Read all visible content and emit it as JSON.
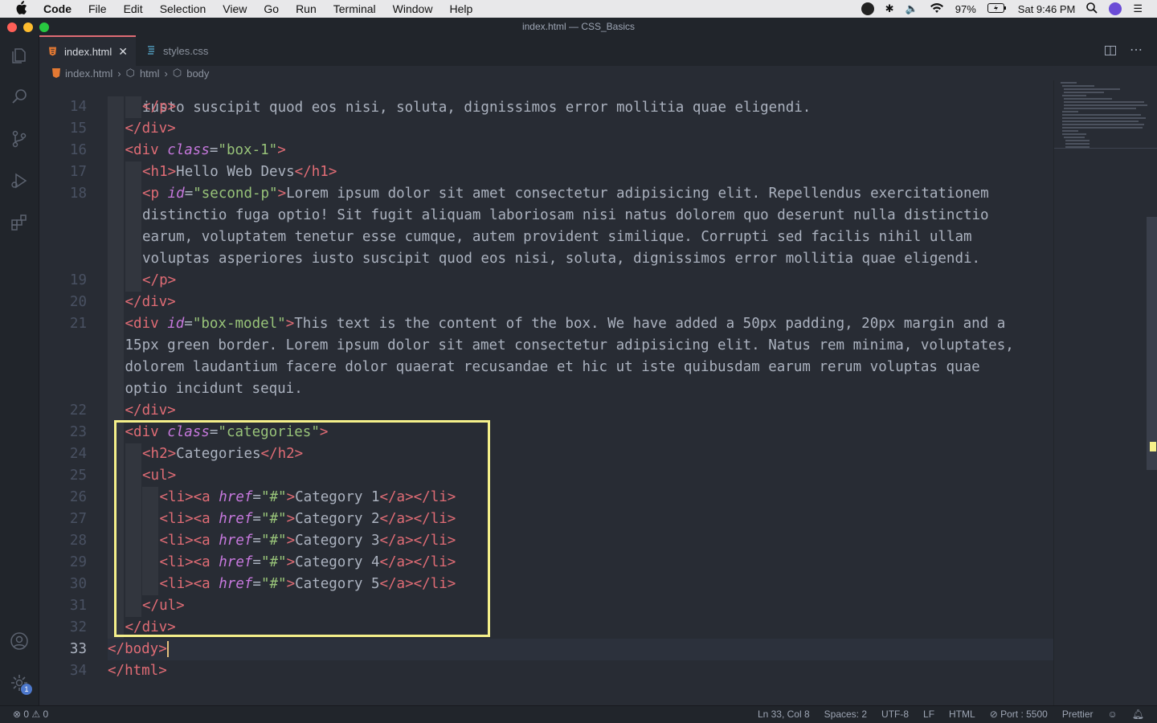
{
  "menubar": {
    "app": "Code",
    "items": [
      "File",
      "Edit",
      "Selection",
      "View",
      "Go",
      "Run",
      "Terminal",
      "Window",
      "Help"
    ],
    "battery": "97%",
    "clock": "Sat 9:46 PM"
  },
  "window": {
    "title": "index.html — CSS_Basics"
  },
  "tabs": [
    {
      "label": "index.html",
      "active": true
    },
    {
      "label": "styles.css",
      "active": false
    }
  ],
  "breadcrumb": [
    "index.html",
    "html",
    "body"
  ],
  "editor": {
    "top_partial": "iusto suscipit quod eos nisi, soluta, dignissimos error mollitia quae eligendi.",
    "lines": [
      {
        "n": "14",
        "ind": 2,
        "segs": [
          [
            "t",
            "</p>"
          ]
        ]
      },
      {
        "n": "15",
        "ind": 1,
        "segs": [
          [
            "t",
            "</div>"
          ]
        ]
      },
      {
        "n": "16",
        "ind": 1,
        "segs": [
          [
            "t",
            "<div "
          ],
          [
            "a",
            "class"
          ],
          [
            "p",
            "="
          ],
          [
            "s",
            "\"box-1\""
          ],
          [
            "t",
            ">"
          ]
        ]
      },
      {
        "n": "17",
        "ind": 2,
        "segs": [
          [
            "t",
            "<h1>"
          ],
          [
            "p",
            "Hello Web Devs"
          ],
          [
            "t",
            "</h1>"
          ]
        ]
      },
      {
        "n": "18",
        "ind": 2,
        "segs": [
          [
            "t",
            "<p "
          ],
          [
            "a",
            "id"
          ],
          [
            "p",
            "="
          ],
          [
            "s",
            "\"second-p\""
          ],
          [
            "t",
            ">"
          ],
          [
            "p",
            "Lorem ipsum dolor sit amet consectetur adipisicing elit. Repellendus exercitationem"
          ]
        ]
      },
      {
        "n": "",
        "ind": 2,
        "segs": [
          [
            "p",
            "distinctio fuga optio! Sit fugit aliquam laboriosam nisi natus dolorem quo deserunt nulla distinctio"
          ]
        ]
      },
      {
        "n": "",
        "ind": 2,
        "segs": [
          [
            "p",
            "earum, voluptatem tenetur esse cumque, autem provident similique. Corrupti sed facilis nihil ullam"
          ]
        ]
      },
      {
        "n": "",
        "ind": 2,
        "segs": [
          [
            "p",
            "voluptas asperiores iusto suscipit quod eos nisi, soluta, dignissimos error mollitia quae eligendi."
          ]
        ]
      },
      {
        "n": "19",
        "ind": 2,
        "segs": [
          [
            "t",
            "</p>"
          ]
        ]
      },
      {
        "n": "20",
        "ind": 1,
        "segs": [
          [
            "t",
            "</div>"
          ]
        ]
      },
      {
        "n": "21",
        "ind": 1,
        "segs": [
          [
            "t",
            "<div "
          ],
          [
            "a",
            "id"
          ],
          [
            "p",
            "="
          ],
          [
            "s",
            "\"box-model\""
          ],
          [
            "t",
            ">"
          ],
          [
            "p",
            "This text is the content of the box. We have added a 50px padding, 20px margin and a"
          ]
        ]
      },
      {
        "n": "",
        "ind": 1,
        "segs": [
          [
            "p",
            "15px green border. Lorem ipsum dolor sit amet consectetur adipisicing elit. Natus rem minima, voluptates,"
          ]
        ]
      },
      {
        "n": "",
        "ind": 1,
        "segs": [
          [
            "p",
            "dolorem laudantium facere dolor quaerat recusandae et hic ut iste quibusdam earum rerum voluptas quae"
          ]
        ]
      },
      {
        "n": "",
        "ind": 1,
        "segs": [
          [
            "p",
            "optio incidunt sequi."
          ]
        ]
      },
      {
        "n": "22",
        "ind": 1,
        "segs": [
          [
            "t",
            "</div>"
          ]
        ]
      },
      {
        "n": "23",
        "ind": 1,
        "segs": [
          [
            "t",
            "<div "
          ],
          [
            "a",
            "class"
          ],
          [
            "p",
            "="
          ],
          [
            "s",
            "\"categories\""
          ],
          [
            "t",
            ">"
          ]
        ]
      },
      {
        "n": "24",
        "ind": 2,
        "segs": [
          [
            "t",
            "<h2>"
          ],
          [
            "p",
            "Categories"
          ],
          [
            "t",
            "</h2>"
          ]
        ]
      },
      {
        "n": "25",
        "ind": 2,
        "segs": [
          [
            "t",
            "<ul>"
          ]
        ]
      },
      {
        "n": "26",
        "ind": 3,
        "segs": [
          [
            "t",
            "<li><a "
          ],
          [
            "a",
            "href"
          ],
          [
            "p",
            "="
          ],
          [
            "s",
            "\"#\""
          ],
          [
            "t",
            ">"
          ],
          [
            "p",
            "Category 1"
          ],
          [
            "t",
            "</a></li>"
          ]
        ]
      },
      {
        "n": "27",
        "ind": 3,
        "segs": [
          [
            "t",
            "<li><a "
          ],
          [
            "a",
            "href"
          ],
          [
            "p",
            "="
          ],
          [
            "s",
            "\"#\""
          ],
          [
            "t",
            ">"
          ],
          [
            "p",
            "Category 2"
          ],
          [
            "t",
            "</a></li>"
          ]
        ]
      },
      {
        "n": "28",
        "ind": 3,
        "segs": [
          [
            "t",
            "<li><a "
          ],
          [
            "a",
            "href"
          ],
          [
            "p",
            "="
          ],
          [
            "s",
            "\"#\""
          ],
          [
            "t",
            ">"
          ],
          [
            "p",
            "Category 3"
          ],
          [
            "t",
            "</a></li>"
          ]
        ]
      },
      {
        "n": "29",
        "ind": 3,
        "segs": [
          [
            "t",
            "<li><a "
          ],
          [
            "a",
            "href"
          ],
          [
            "p",
            "="
          ],
          [
            "s",
            "\"#\""
          ],
          [
            "t",
            ">"
          ],
          [
            "p",
            "Category 4"
          ],
          [
            "t",
            "</a></li>"
          ]
        ]
      },
      {
        "n": "30",
        "ind": 3,
        "segs": [
          [
            "t",
            "<li><a "
          ],
          [
            "a",
            "href"
          ],
          [
            "p",
            "="
          ],
          [
            "s",
            "\"#\""
          ],
          [
            "t",
            ">"
          ],
          [
            "p",
            "Category 5"
          ],
          [
            "t",
            "</a></li>"
          ]
        ]
      },
      {
        "n": "31",
        "ind": 2,
        "segs": [
          [
            "t",
            "</ul>"
          ]
        ]
      },
      {
        "n": "32",
        "ind": 1,
        "segs": [
          [
            "t",
            "</div>"
          ]
        ]
      },
      {
        "n": "33",
        "ind": 0,
        "segs": [
          [
            "t",
            "</body>"
          ]
        ],
        "current": true
      },
      {
        "n": "34",
        "ind": 0,
        "segs": [
          [
            "t",
            "</html>"
          ]
        ]
      }
    ]
  },
  "status": {
    "problems": "⊗ 0 ⚠ 0",
    "cursor": "Ln 33, Col 8",
    "spaces": "Spaces: 2",
    "encoding": "UTF-8",
    "eol": "LF",
    "language": "HTML",
    "port": "⊘ Port : 5500",
    "formatter": "Prettier"
  },
  "activity_badge": "1",
  "colors": {
    "highlight": "#f5f08a",
    "tag": "#e06c75",
    "attr": "#c678dd",
    "string": "#98c379"
  }
}
